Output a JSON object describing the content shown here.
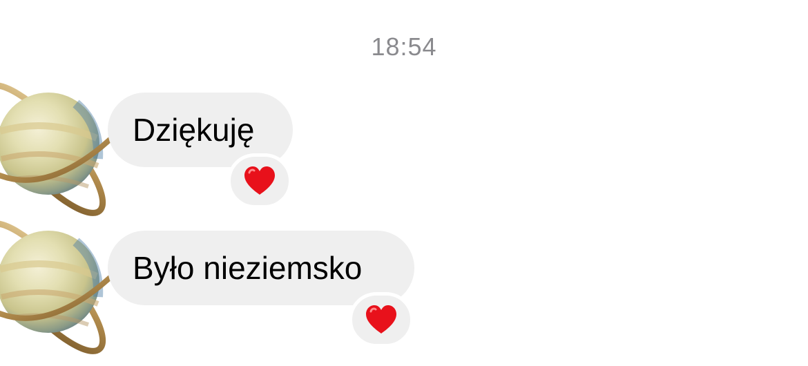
{
  "conversation": {
    "timestamp": "18:54",
    "messages": [
      {
        "text": "Dziękuję",
        "reaction": "red-heart",
        "avatar": "saturn-planet"
      },
      {
        "text": "Było nieziemsko",
        "reaction": "red-heart",
        "avatar": "saturn-planet"
      }
    ]
  },
  "colors": {
    "bubble": "#efefef",
    "timestamp": "#8a8a8e",
    "heart": "#e8111b"
  }
}
